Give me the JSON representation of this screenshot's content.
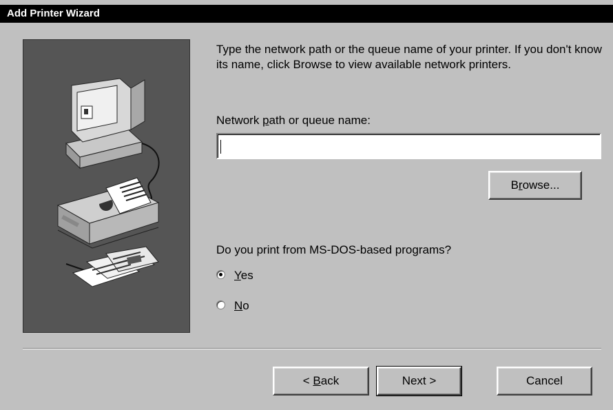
{
  "window": {
    "title": "Add Printer Wizard"
  },
  "description": "Type the network path or the queue name of your printer. If you don't know its name, click Browse to view available network printers.",
  "network_path": {
    "label_pre": "Network ",
    "label_accel": "p",
    "label_post": "ath or queue name:",
    "value": ""
  },
  "browse_button": {
    "accel": "r",
    "pre": "B",
    "post": "owse..."
  },
  "msdos": {
    "question": "Do you print from MS-DOS-based programs?",
    "options": [
      {
        "accel": "Y",
        "rest": "es",
        "selected": true
      },
      {
        "accel": "N",
        "rest": "o",
        "selected": false
      }
    ]
  },
  "buttons": {
    "back": {
      "prefix": "< ",
      "accel": "B",
      "rest": "ack"
    },
    "next": {
      "label": "Next >"
    },
    "cancel": {
      "label": "Cancel"
    }
  },
  "illustration_icons": [
    "computer-icon",
    "printer-icon",
    "documents-icon"
  ]
}
